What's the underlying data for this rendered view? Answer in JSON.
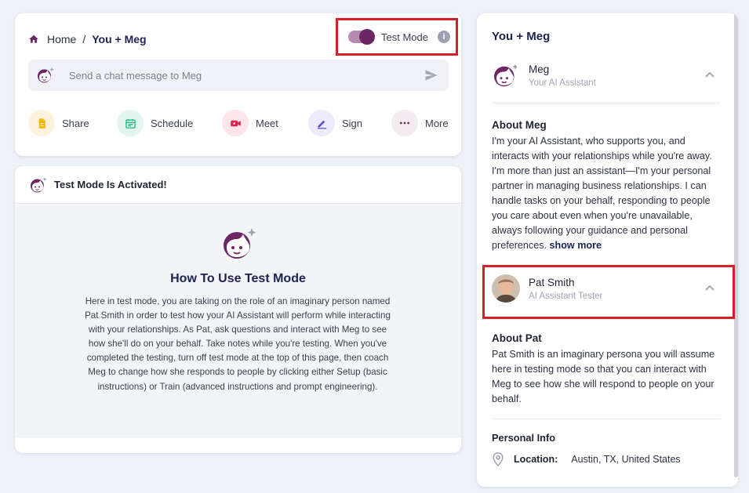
{
  "breadcrumb": {
    "home": "Home",
    "separator": "/",
    "current": "You + Meg"
  },
  "test_mode": {
    "label": "Test Mode",
    "enabled": true,
    "info_icon": "i"
  },
  "chat": {
    "placeholder": "Send a chat message to Meg"
  },
  "actions": [
    {
      "label": "Share",
      "icon": "document-icon",
      "bg": "#fdf3dc",
      "color": "#f5b800"
    },
    {
      "label": "Schedule",
      "icon": "calendar-icon",
      "bg": "#e2f6ef",
      "color": "#1bb583"
    },
    {
      "label": "Meet",
      "icon": "video-icon",
      "bg": "#fde6ea",
      "color": "#d8244a"
    },
    {
      "label": "Sign",
      "icon": "pen-icon",
      "bg": "#eceafb",
      "color": "#5b4fd4"
    },
    {
      "label": "More",
      "icon": "more-icon",
      "bg": "#f4ebf1",
      "color": "#6b2763"
    }
  ],
  "test_notice": {
    "header": "Test Mode Is Activated!",
    "title": "How To Use Test Mode",
    "body": "Here in test mode, you are taking on the role of an imaginary person named Pat Smith in order to test how your AI Assistant will perform while interacting with your relationships. As Pat, ask questions and interact with Meg to see how she'll do on your behalf. Take notes while you're testing. When you've completed the testing, turn off test mode at the top of this page, then coach Meg to change how she responds to people by clicking either Setup (basic instructions) or Train (advanced instructions and prompt engineering)."
  },
  "right_panel": {
    "title": "You + Meg",
    "assistant": {
      "name": "Meg",
      "role": "Your AI Assistant"
    },
    "about_meg": {
      "title": "About Meg",
      "text": "I'm your AI Assistant, who supports you, and interacts with your relationships while you're away. I'm more than just an assistant—I'm your personal partner in managing business relationships. I can handle tasks on your behalf, responding to people you care about even when you're unavailable, always following your guidance and personal preferences.",
      "show_more": "show more"
    },
    "tester": {
      "name": "Pat Smith",
      "role": "AI Assistant Tester"
    },
    "about_pat": {
      "title": "About Pat",
      "text": "Pat Smith is an imaginary persona you will assume here in testing mode so that you can interact with Meg to see how she will respond to people on your behalf."
    },
    "personal_info": {
      "title": "Personal Info",
      "location_label": "Location:",
      "location_value": "Austin, TX, United States"
    }
  },
  "colors": {
    "brand": "#6b2763",
    "highlight": "#d61f26",
    "navy": "#1c2353"
  }
}
